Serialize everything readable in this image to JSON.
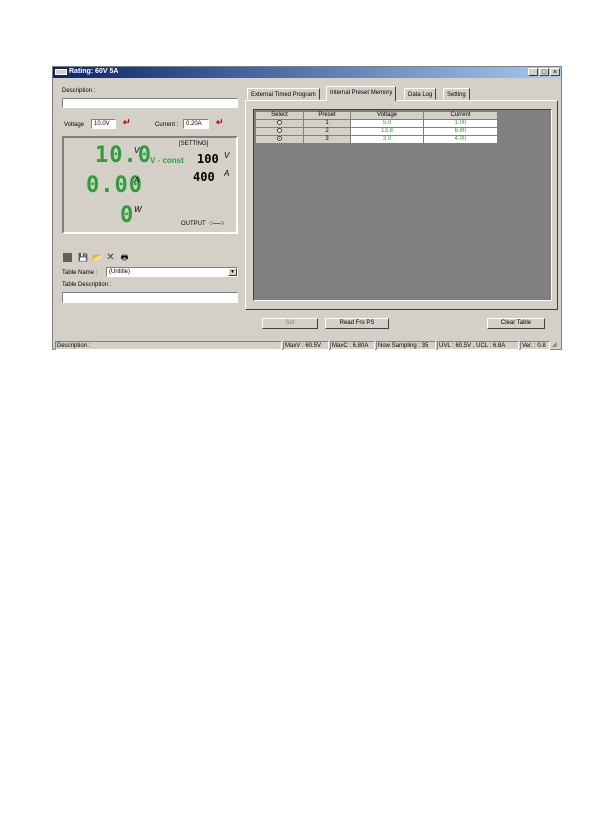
{
  "window": {
    "title": "Rating: 60V 5A"
  },
  "left": {
    "description_label": "Description :",
    "description_value": "",
    "voltage_label": "Voltage",
    "voltage_value": "10.0V",
    "current_label": "Current :",
    "current_value": "0.20A"
  },
  "display": {
    "voltage": "10.0",
    "voltage_unit": "V",
    "mode": "V - const",
    "current": "0.00",
    "current_unit": "A",
    "power": "0",
    "power_unit": "W",
    "setting_label": "[SETTING]",
    "set_voltage": "100",
    "set_voltage_unit": "V",
    "set_current": "400",
    "set_current_unit": "A",
    "output_label": "OUTPUT"
  },
  "table_panel": {
    "table_name_label": "Table Name :",
    "table_name_value": "(Untitle)",
    "table_description_label": "Table Description :",
    "table_description_value": ""
  },
  "tabs": [
    "External Timed Program",
    "Internal Preset Memory",
    "Data Log",
    "Setting"
  ],
  "preset_table": {
    "headers": [
      "Select",
      "Preset",
      "Voltage",
      "Current"
    ],
    "rows": [
      {
        "preset": "1",
        "voltage": "5.0",
        "current": "1.00",
        "selected": false
      },
      {
        "preset": "2",
        "voltage": "13.8",
        "current": "6.80",
        "selected": false
      },
      {
        "preset": "3",
        "voltage": "3.0",
        "current": "4.00",
        "selected": true
      }
    ]
  },
  "buttons": {
    "set": "Set",
    "read": "Read Fro PS",
    "clear": "Clear Table"
  },
  "status": {
    "description": "Description :",
    "maxv": "MaxV : 60.5V",
    "maxc": "MaxC : 6.80A",
    "sampling": "Now Sampling : 35",
    "uvl": "UVL : 60.5V , UCL : 6.8A",
    "ver": "Ver. : 0.8"
  },
  "colors": {
    "segment_green": "#2e9e3a",
    "arrow_red": "#c00000",
    "title_blue": "#0a246a"
  }
}
